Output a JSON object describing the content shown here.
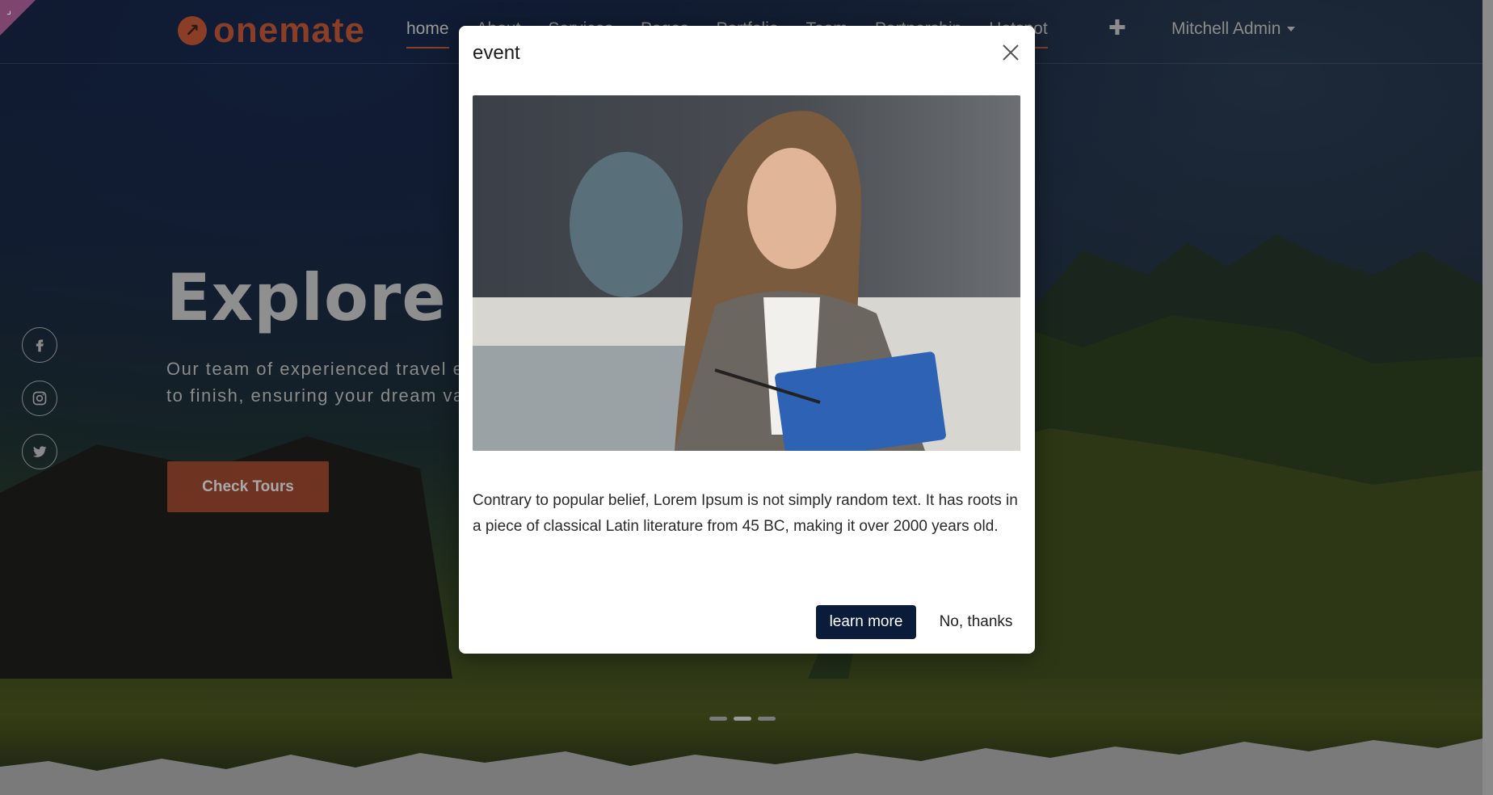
{
  "brand": {
    "name": "onemate"
  },
  "nav": {
    "items": [
      "home",
      "About",
      "Services",
      "Pages",
      "Portfolio",
      "Team",
      "Partnership",
      "Hotspot"
    ],
    "add_icon": "plus-icon",
    "user": "Mitchell Admin"
  },
  "hero": {
    "title": "Explore Y",
    "text": "Our team of experienced travel experts will help you to finish, ensuring your dream vacation lasts longer",
    "button": "Check Tours",
    "slides_total": 3,
    "slide_active": 2
  },
  "social": [
    "facebook-icon",
    "instagram-icon",
    "twitter-icon"
  ],
  "modal": {
    "title": "event",
    "body": "Contrary to popular belief, Lorem Ipsum is not simply random text. It has roots in a piece of classical Latin literature from 45 BC, making it over 2000 years old.",
    "primary_button": "learn more",
    "secondary_button": "No, thanks",
    "accent_color": "#0b1c3a"
  },
  "colors": {
    "brand": "#8a3e26"
  }
}
